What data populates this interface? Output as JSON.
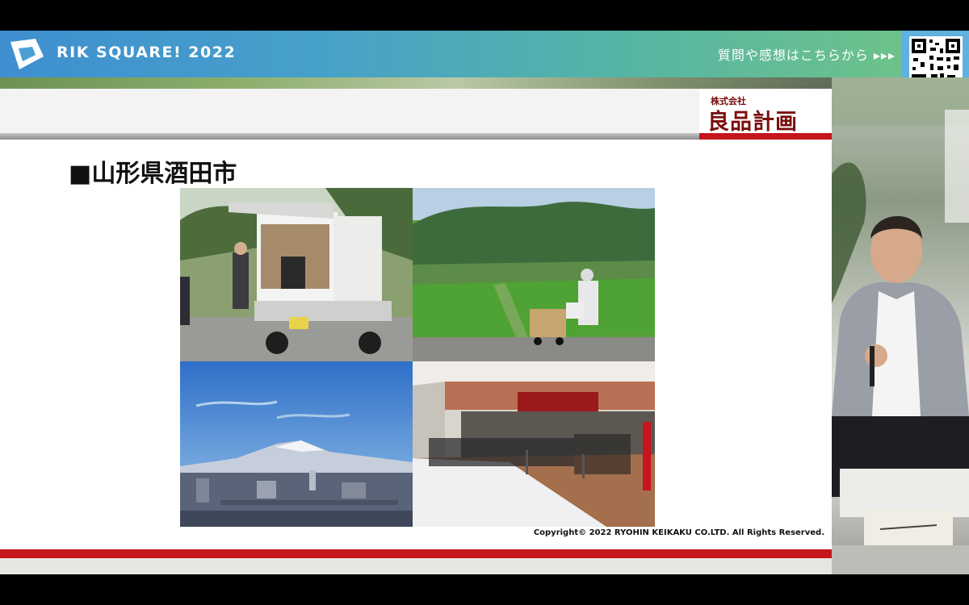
{
  "header": {
    "event_title": "RIK SQUARE! 2022",
    "question_cta": "質問や感想はこちらから ▸▸▸"
  },
  "slide": {
    "brand_small": "株式会社",
    "brand_name": "良品計画",
    "title": "■山形県酒田市",
    "copyright": "Copyright© 2022 RYOHIN KEIKAKU CO.LTD. All Rights Reserved."
  },
  "colors": {
    "accent_red": "#c4161c",
    "header_blue": "#3f8fd0",
    "header_green": "#6cc28a"
  },
  "icons": {
    "logo": "rik-logo-icon",
    "qr": "qr-code-icon"
  }
}
